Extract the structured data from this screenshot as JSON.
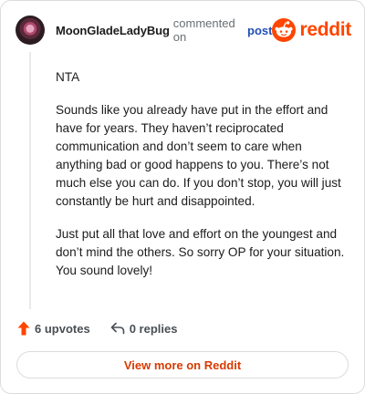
{
  "comment": {
    "author": "MoonGladeLadyBug",
    "action_text": "commented on",
    "post_link": "post",
    "paragraphs": [
      "NTA",
      "Sounds like you already have put in the effort and have for years. They haven’t reciprocated communication and don’t seem to care when anything bad or good happens to you. There’s not much else you can do. If you don’t stop, you will just constantly be hurt and disappointed.",
      "Just put all that love and effort on the youngest and don’t mind the others. So sorry OP for your situation. You sound lovely!"
    ],
    "upvotes_label": "6 upvotes",
    "replies_label": "0 replies"
  },
  "brand": {
    "wordmark": "reddit",
    "icon": "reddit-snoo-icon",
    "color": "#ff4500"
  },
  "footer": {
    "cta_label": "View more on Reddit",
    "cta_color": "#d93a00"
  },
  "icons": {
    "upvote": "upvote-arrow-icon",
    "reply": "reply-arrow-icon",
    "avatar": "user-avatar"
  }
}
